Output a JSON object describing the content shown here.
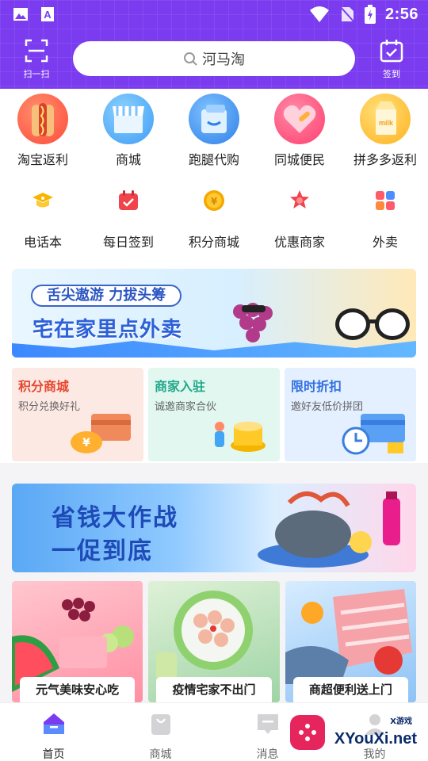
{
  "status_bar": {
    "time": "2:56"
  },
  "header": {
    "scan_label": "扫一扫",
    "search_placeholder": "河马淘",
    "sign_label": "签到"
  },
  "categories": [
    {
      "label": "淘宝返利",
      "icon": "hotdog-icon",
      "color": "#ff5a48"
    },
    {
      "label": "商城",
      "icon": "shop-icon",
      "color": "#4aa9ff"
    },
    {
      "label": "跑腿代购",
      "icon": "bag-icon",
      "color": "#3b8ef5"
    },
    {
      "label": "同城便民",
      "icon": "heart-icon",
      "color": "#ff4d7a"
    },
    {
      "label": "拼多多返利",
      "icon": "milk-icon",
      "color": "#ffbf2a"
    }
  ],
  "tools": [
    {
      "label": "电话本",
      "icon": "graduation-cap-icon",
      "color": "#f7b500"
    },
    {
      "label": "每日签到",
      "icon": "calendar-check-icon",
      "color": "#f0434b"
    },
    {
      "label": "积分商城",
      "icon": "coin-icon",
      "color": "#f5a800"
    },
    {
      "label": "优惠商家",
      "icon": "star-badge-icon",
      "color": "#f0434b"
    },
    {
      "label": "外卖",
      "icon": "apps-grid-icon",
      "color": "#ff5a6a"
    }
  ],
  "banner1": {
    "pill": "舌尖遨游 力拔头筹",
    "title": "宅在家里点外卖"
  },
  "promo_cards": [
    {
      "title": "积分商城",
      "subtitle": "积分兑换好礼",
      "title_color": "#e8472f",
      "bg": "#fde9e4"
    },
    {
      "title": "商家入驻",
      "subtitle": "诚邀商家合伙",
      "title_color": "#22a98a",
      "bg": "#e1f7ef"
    },
    {
      "title": "限时折扣",
      "subtitle": "邀好友低价拼团",
      "title_color": "#2f6fe0",
      "bg": "#e4efff"
    }
  ],
  "banner2": {
    "line1": "省钱大作战",
    "line2": "一促到底"
  },
  "products": [
    {
      "caption": "元气美味安心吃"
    },
    {
      "caption": "疫情宅家不出门"
    },
    {
      "caption": "商超便利送上门"
    }
  ],
  "tabbar": [
    {
      "label": "首页",
      "active": true
    },
    {
      "label": "商城",
      "active": false
    },
    {
      "label": "消息",
      "active": false
    },
    {
      "label": "我的",
      "active": false
    }
  ],
  "watermark": {
    "text": "XYouXi.net",
    "sub": "X游戏"
  }
}
